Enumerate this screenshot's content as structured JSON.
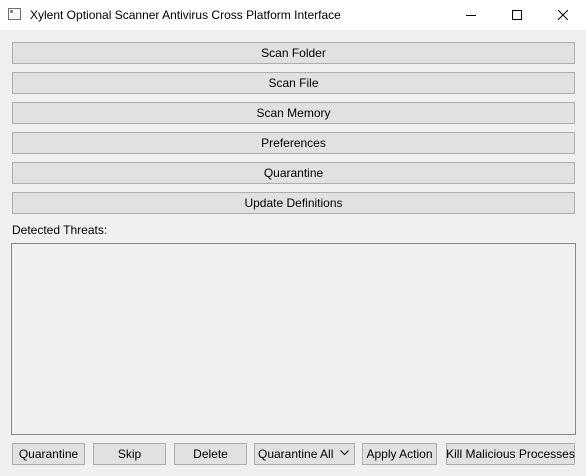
{
  "window": {
    "title": "Xylent Optional Scanner Antivirus Cross Platform Interface"
  },
  "actions": {
    "scan_folder": "Scan Folder",
    "scan_file": "Scan File",
    "scan_memory": "Scan Memory",
    "preferences": "Preferences",
    "quarantine": "Quarantine",
    "update_definitions": "Update Definitions"
  },
  "threats": {
    "label": "Detected Threats:",
    "items": []
  },
  "bottom_bar": {
    "quarantine": "Quarantine",
    "skip": "Skip",
    "delete": "Delete",
    "action_select": {
      "selected": "Quarantine All"
    },
    "apply_action": "Apply Action",
    "kill_processes": "Kill Malicious Processes"
  },
  "icons": {
    "app": "app-window-icon",
    "minimize": "minimize-icon",
    "maximize": "maximize-icon",
    "close": "close-icon",
    "dropdown": "chevron-down-icon"
  }
}
